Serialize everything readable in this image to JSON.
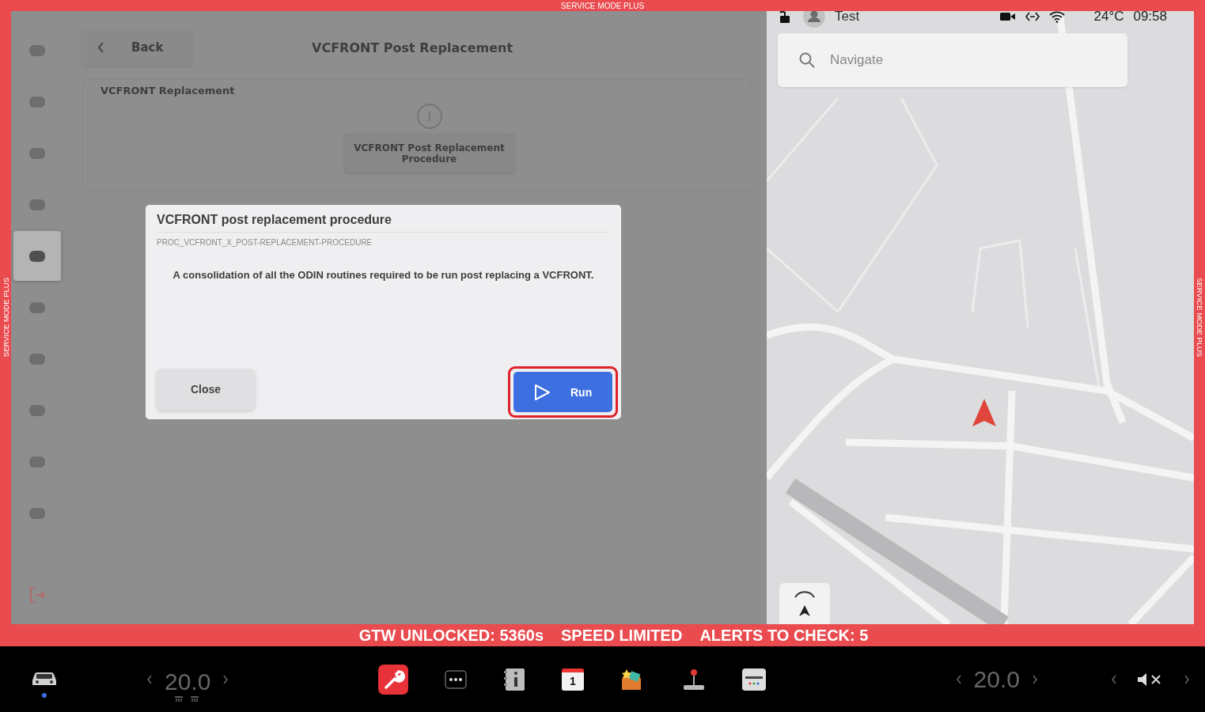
{
  "frame": {
    "banner_top": "SERVICE MODE PLUS",
    "banner_left": "SERVICE MODE PLUS",
    "banner_right": "SERVICE MODE PLUS"
  },
  "sidebar": {
    "items": [
      {
        "selected": false
      },
      {
        "selected": false
      },
      {
        "selected": false
      },
      {
        "selected": false
      },
      {
        "selected": true
      },
      {
        "selected": false
      },
      {
        "selected": false
      },
      {
        "selected": false
      },
      {
        "selected": false
      },
      {
        "selected": false
      }
    ]
  },
  "page": {
    "back": "Back",
    "title": "VCFRONT Post Replacement",
    "section": "VCFRONT Replacement",
    "procedure_button": "VCFRONT Post Replacement Procedure"
  },
  "dialog": {
    "title": "VCFRONT post replacement procedure",
    "code": "PROC_VCFRONT_X_POST-REPLACEMENT-PROCEDURE",
    "description": "A consolidation of all the ODIN routines required to be run post replacing a VCFRONT.",
    "buttons": [
      {
        "kind": "secondary",
        "label": "Close",
        "highlighted": false
      },
      {
        "kind": "primary",
        "label": "Run",
        "highlighted": true
      }
    ]
  },
  "status_bar": {
    "locked": false,
    "user": "Test",
    "temperature": "24°C",
    "time": "09:58"
  },
  "map": {
    "search": {
      "placeholder": "Navigate"
    }
  },
  "alerts": [
    "GTW UNLOCKED: 5360s",
    "SPEED LIMITED",
    "ALERTS TO CHECK: 5"
  ],
  "dock": {
    "left_temp": "20.0",
    "right_temp": "20.0",
    "calendar_day": "1",
    "muted": true
  }
}
